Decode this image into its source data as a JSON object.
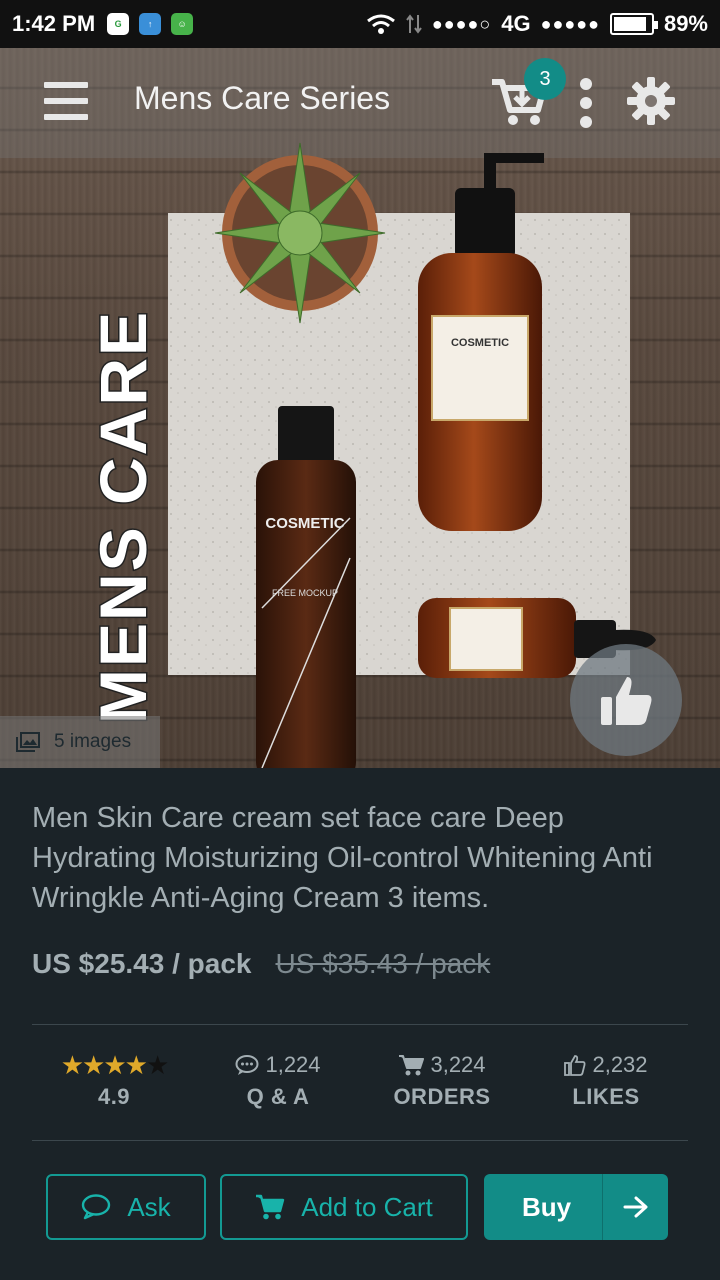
{
  "status_bar": {
    "time": "1:42 PM",
    "network": "4G",
    "battery": "89%",
    "battery_level": 0.89
  },
  "app_bar": {
    "title": "Mens Care Series",
    "cart_count": "3",
    "icons": [
      "menu-icon",
      "cart-icon",
      "more-vertical-icon",
      "gear-icon"
    ]
  },
  "hero": {
    "overlay_text": "MENS CARE",
    "bottle_label": "COSMETIC",
    "bottle_sublabel": "FREE MOCKUP",
    "image_count_label": "5 images"
  },
  "product": {
    "description": "Men Skin Care cream set face care Deep Hydrating Moisturizing Oil-control Whitening Anti Wringkle Anti-Aging Cream 3 items.",
    "price": "US $25.43 / pack",
    "old_price": "US $35.43 / pack"
  },
  "stats": {
    "rating": "4.9",
    "rating_value": 4.9,
    "qa_count": "1,224",
    "qa_label": "Q & A",
    "orders_count": "3,224",
    "orders_label": "ORDERS",
    "likes_count": "2,232",
    "likes_label": "LIKES"
  },
  "actions": {
    "ask_label": "Ask",
    "add_to_cart_label": "Add to Cart",
    "buy_label": "Buy"
  },
  "colors": {
    "accent": "#128c87",
    "panel_bg": "#1b2328",
    "text_muted": "#a3aeb3",
    "star": "#e0a92a"
  }
}
